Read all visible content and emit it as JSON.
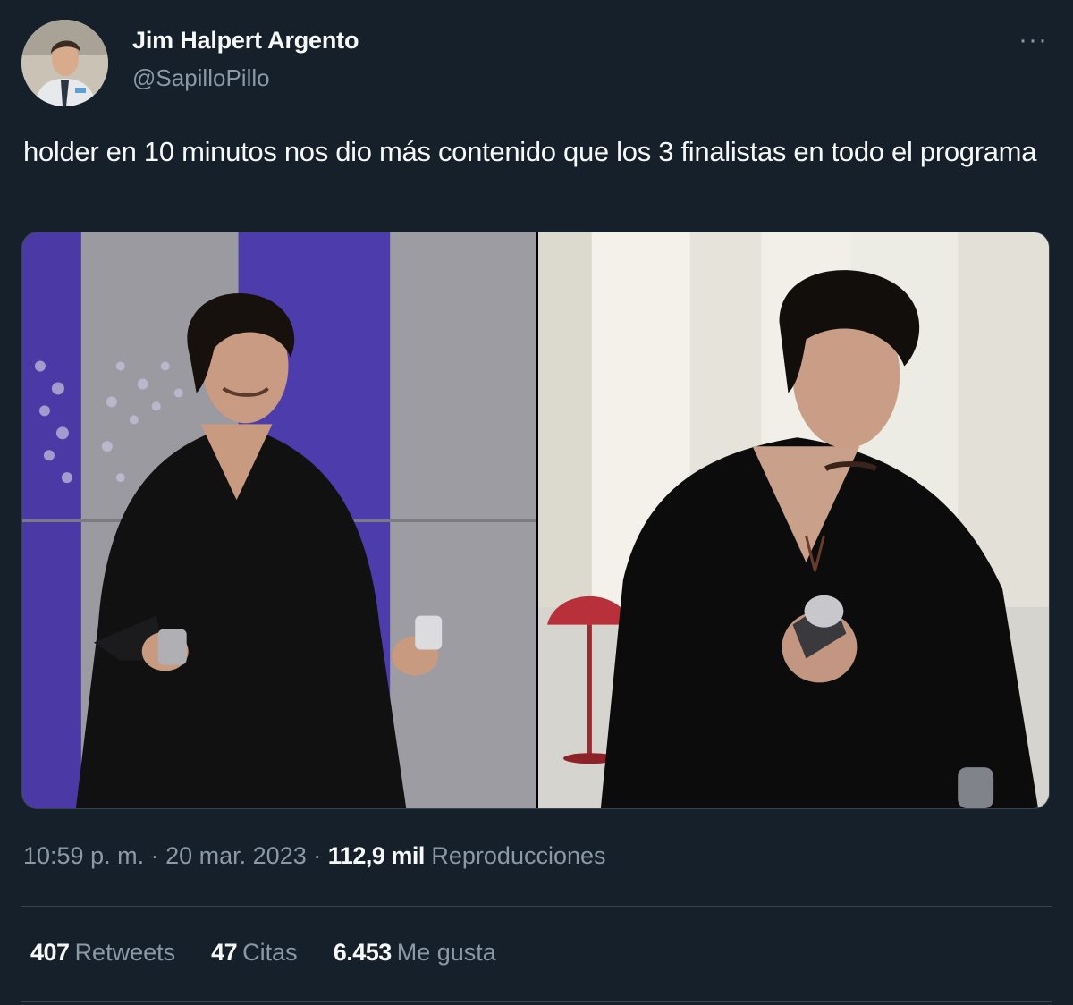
{
  "author": {
    "display_name": "Jim Halpert Argento",
    "handle": "@SapilloPillo"
  },
  "more_glyph": "···",
  "tweet": {
    "text": "holder en 10 minutos nos dio más contenido que los 3 finalistas en todo el programa"
  },
  "meta": {
    "time": "10:59 p. m.",
    "separator": "·",
    "date": "20 mar. 2023",
    "views_count": "112,9 mil",
    "views_label": "Reproducciones"
  },
  "stats": {
    "retweets_count": "407",
    "retweets_label": "Retweets",
    "quotes_count": "47",
    "quotes_label": "Citas",
    "likes_count": "6.453",
    "likes_label": "Me gusta"
  },
  "colors": {
    "background": "#15202b",
    "primary_text": "#f7f9f9",
    "secondary_text": "#8b98a5",
    "border": "#38444d"
  }
}
